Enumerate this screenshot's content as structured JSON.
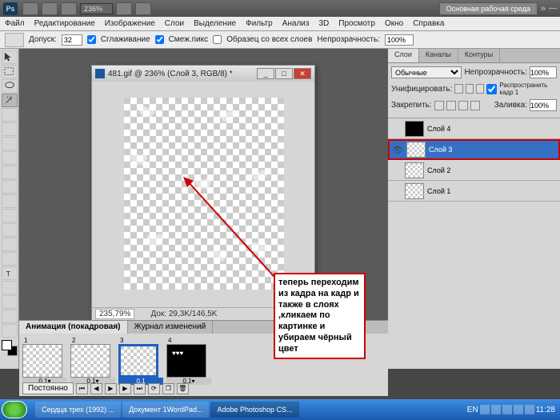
{
  "topbar": {
    "zoom": "236%",
    "workspace": "Основная рабочая среда",
    "chev": "»"
  },
  "menu": {
    "file": "Файл",
    "edit": "Редактирование",
    "image": "Изображение",
    "layers": "Слои",
    "select": "Выделение",
    "filter": "Фильтр",
    "analysis": "Анализ",
    "threed": "3D",
    "view": "Просмотр",
    "window": "Окно",
    "help": "Справка"
  },
  "options": {
    "tolerance_label": "Допуск:",
    "tolerance": "32",
    "smooth": "Сглаживание",
    "contig": "Смеж.пикс",
    "allLayers": "Образец со всех слоев",
    "opacity_label": "Непрозрачность:",
    "opacity": "100%"
  },
  "doc": {
    "title": "481.gif @ 236% (Слой 3, RGB/8) *",
    "zoom": "235,79%",
    "info": "Док: 29,3K/146,5K"
  },
  "annotation": "теперь переходим из кадра на кадр и также в слоях ,кликаем по картинке и убираем чёрный цвет",
  "layersPanel": {
    "tabs": {
      "layers": "Слои",
      "channels": "Каналы",
      "paths": "Контуры"
    },
    "mode": "Обычные",
    "opacity_label": "Непрозрачность:",
    "opacity": "100%",
    "unify_label": "Унифицировать:",
    "propagate": "Распространить кадр 1",
    "lock_label": "Закрепить:",
    "fill_label": "Заливка:",
    "fill": "100%",
    "layers": [
      {
        "name": "Слой 4",
        "selected": false,
        "black": true,
        "eye": ""
      },
      {
        "name": "Слой 3",
        "selected": true,
        "black": false,
        "eye": "👁"
      },
      {
        "name": "Слой 2",
        "selected": false,
        "black": false,
        "eye": ""
      },
      {
        "name": "Слой 1",
        "selected": false,
        "black": false,
        "eye": ""
      }
    ]
  },
  "animation": {
    "tabs": {
      "anim": "Анимация (покадровая)",
      "log": "Журнал изменений"
    },
    "loop": "Постоянно",
    "frames": [
      {
        "num": "1",
        "dur": "0,1▾",
        "black": false,
        "sel": false
      },
      {
        "num": "2",
        "dur": "0,1▾",
        "black": false,
        "sel": false
      },
      {
        "num": "3",
        "dur": "0,1",
        "black": false,
        "sel": true
      },
      {
        "num": "4",
        "dur": "0,1▾",
        "black": true,
        "sel": false
      }
    ]
  },
  "taskbar": {
    "tasks": [
      {
        "label": "Сердца трех (1992) ...",
        "active": false
      },
      {
        "label": "Документ 1WordPad...",
        "active": false
      },
      {
        "label": "Adobe Photoshop CS...",
        "active": true
      }
    ],
    "lang": "EN",
    "time": "11:28"
  }
}
